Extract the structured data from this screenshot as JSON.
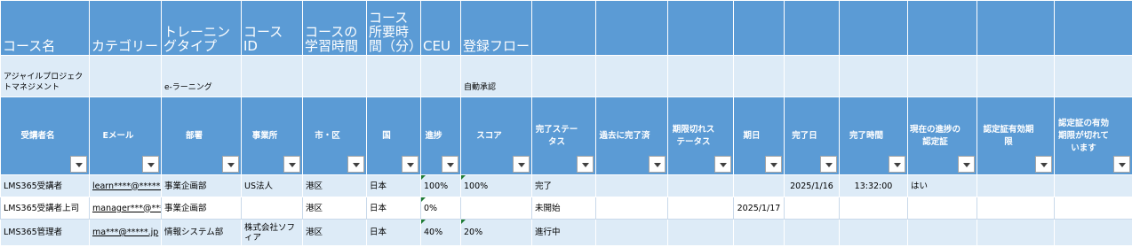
{
  "course_header": {
    "name": "コース名",
    "category": "カテゴリー",
    "training_type": "トレーニングタイプ",
    "course_id": "コース ID",
    "learning_time": "コースの学習時間",
    "required_time": "コース所要時間（分）",
    "ceu": "CEU",
    "registration_flow": "登録フロー"
  },
  "course": {
    "name": "アジャイルプロジェクトマネジメント",
    "category": "",
    "training_type": "e-ラーニング",
    "course_id": "",
    "learning_time": "",
    "required_time": "",
    "ceu": "",
    "registration_flow": "自動承認"
  },
  "learner_header": {
    "learner_name": "受講者名",
    "email": "Eメール",
    "department": "部署",
    "office": "事業所",
    "city": "市・区",
    "country": "国",
    "progress": "進捗",
    "score": "スコア",
    "completion_status": "完了ステータス",
    "past_completed": "過去に完了済",
    "expired_status": "期限切れステータス",
    "due_date": "期日",
    "completion_date": "完了日",
    "completion_time": "完了時間",
    "current_cert": "現在の進捗の認定証",
    "cert_expiry": "認定証有効期限",
    "cert_expired": "認定証の有効期限が切れています"
  },
  "rows": [
    {
      "learner_name": "LMS365受講者",
      "email": "learn****@*****.jp",
      "department": "事業企画部",
      "office": "US法人",
      "city": "港区",
      "country": "日本",
      "progress": "100%",
      "score": "100%",
      "completion_status": "完了",
      "past_completed": "",
      "expired_status": "",
      "due_date": "",
      "completion_date": "2025/1/16",
      "completion_time": "13:32:00",
      "current_cert": "はい",
      "cert_expiry": "",
      "cert_expired": ""
    },
    {
      "learner_name": "LMS365受講者上司",
      "email": "manager***@*****.jp",
      "department": "事業企画部",
      "office": "",
      "city": "港区",
      "country": "日本",
      "progress": "0%",
      "score": "",
      "completion_status": "未開始",
      "past_completed": "",
      "expired_status": "",
      "due_date": "2025/1/17",
      "completion_date": "",
      "completion_time": "",
      "current_cert": "",
      "cert_expiry": "",
      "cert_expired": ""
    },
    {
      "learner_name": "LMS365管理者",
      "email": "ma***@*****.jp",
      "department": "情報システム部",
      "office": "株式会社ソフィア",
      "city": "港区",
      "country": "日本",
      "progress": "40%",
      "score": "20%",
      "completion_status": "進行中",
      "past_completed": "",
      "expired_status": "",
      "due_date": "",
      "completion_date": "",
      "completion_time": "",
      "current_cert": "",
      "cert_expiry": "",
      "cert_expired": ""
    }
  ],
  "colors": {
    "header_blue": "#5b9bd5",
    "band_light": "#ddebf7",
    "link": "#0563c1",
    "error_marker": "#1e7b34"
  },
  "icons": {
    "filter": "filter-dropdown-icon",
    "indicator": "number-as-text-indicator"
  }
}
